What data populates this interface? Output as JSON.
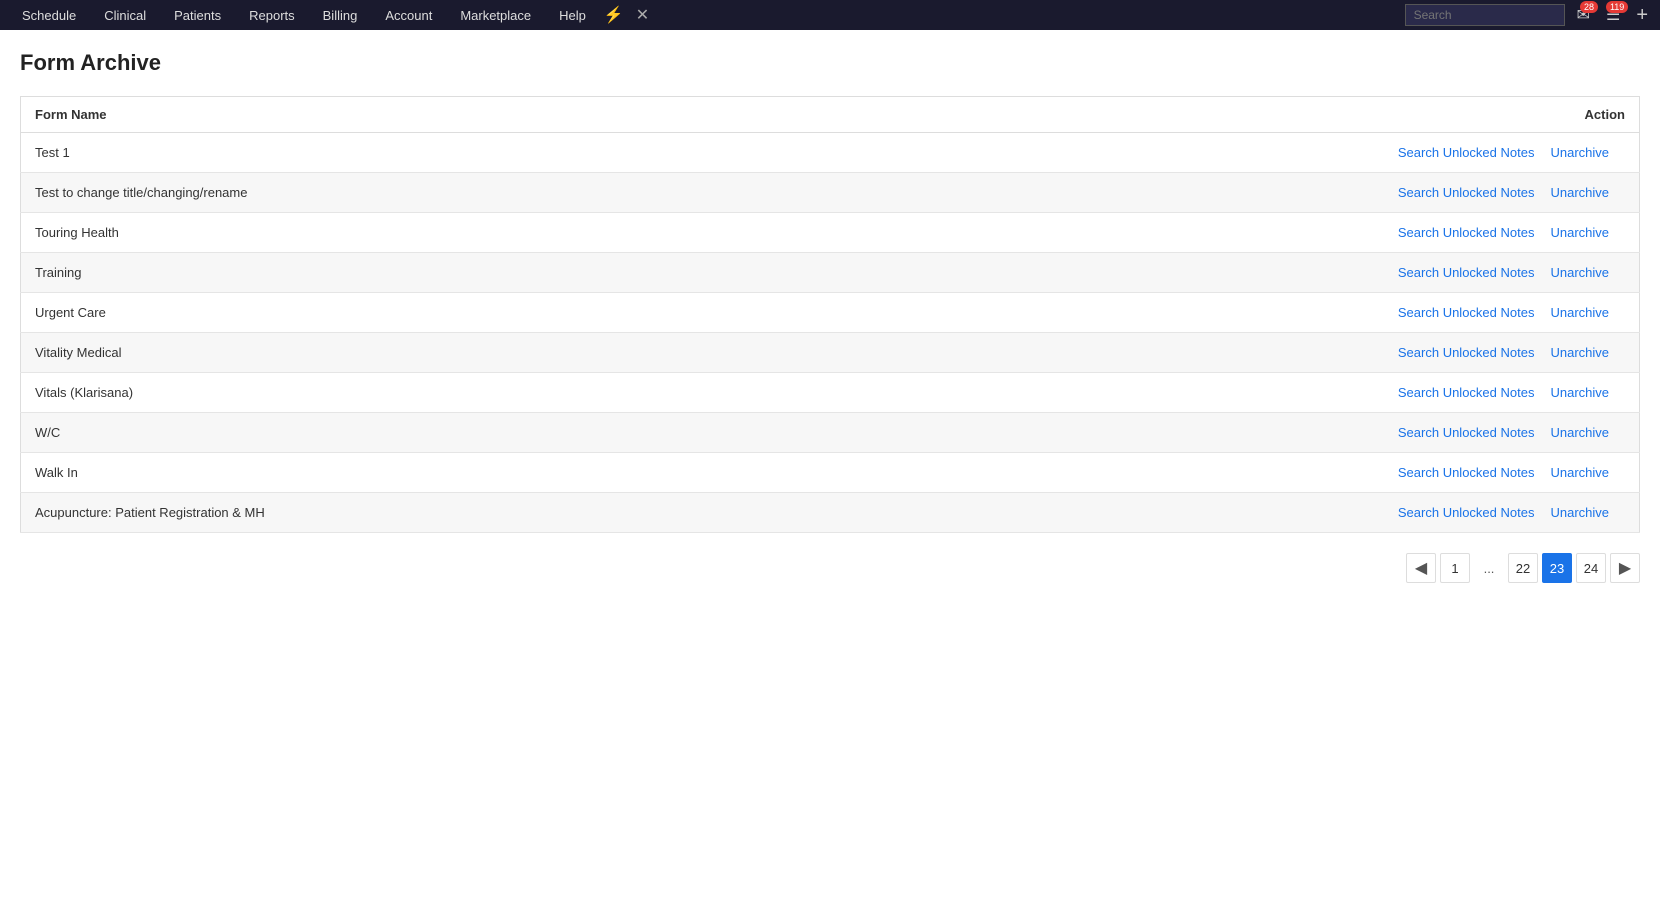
{
  "nav": {
    "items": [
      {
        "label": "Schedule",
        "id": "schedule"
      },
      {
        "label": "Clinical",
        "id": "clinical"
      },
      {
        "label": "Patients",
        "id": "patients"
      },
      {
        "label": "Reports",
        "id": "reports"
      },
      {
        "label": "Billing",
        "id": "billing"
      },
      {
        "label": "Account",
        "id": "account"
      },
      {
        "label": "Marketplace",
        "id": "marketplace"
      },
      {
        "label": "Help",
        "id": "help"
      }
    ],
    "search_placeholder": "Search",
    "mail_badge": "28",
    "notif_badge": "119"
  },
  "page": {
    "title": "Form Archive",
    "table": {
      "col_form_name": "Form Name",
      "col_action": "Action",
      "rows": [
        {
          "form_name": "Test 1"
        },
        {
          "form_name": "Test to change title/changing/rename"
        },
        {
          "form_name": "Touring Health"
        },
        {
          "form_name": "Training"
        },
        {
          "form_name": "Urgent Care"
        },
        {
          "form_name": "Vitality Medical"
        },
        {
          "form_name": "Vitals (Klarisana)"
        },
        {
          "form_name": "W/C"
        },
        {
          "form_name": "Walk In"
        },
        {
          "form_name": "Acupuncture: Patient Registration & MH"
        }
      ],
      "action_search": "Search Unlocked Notes",
      "action_unarchive": "Unarchive"
    }
  },
  "pagination": {
    "prev_label": "◀",
    "next_label": "▶",
    "pages": [
      "1",
      "...",
      "22",
      "23",
      "24"
    ],
    "current": "23"
  }
}
